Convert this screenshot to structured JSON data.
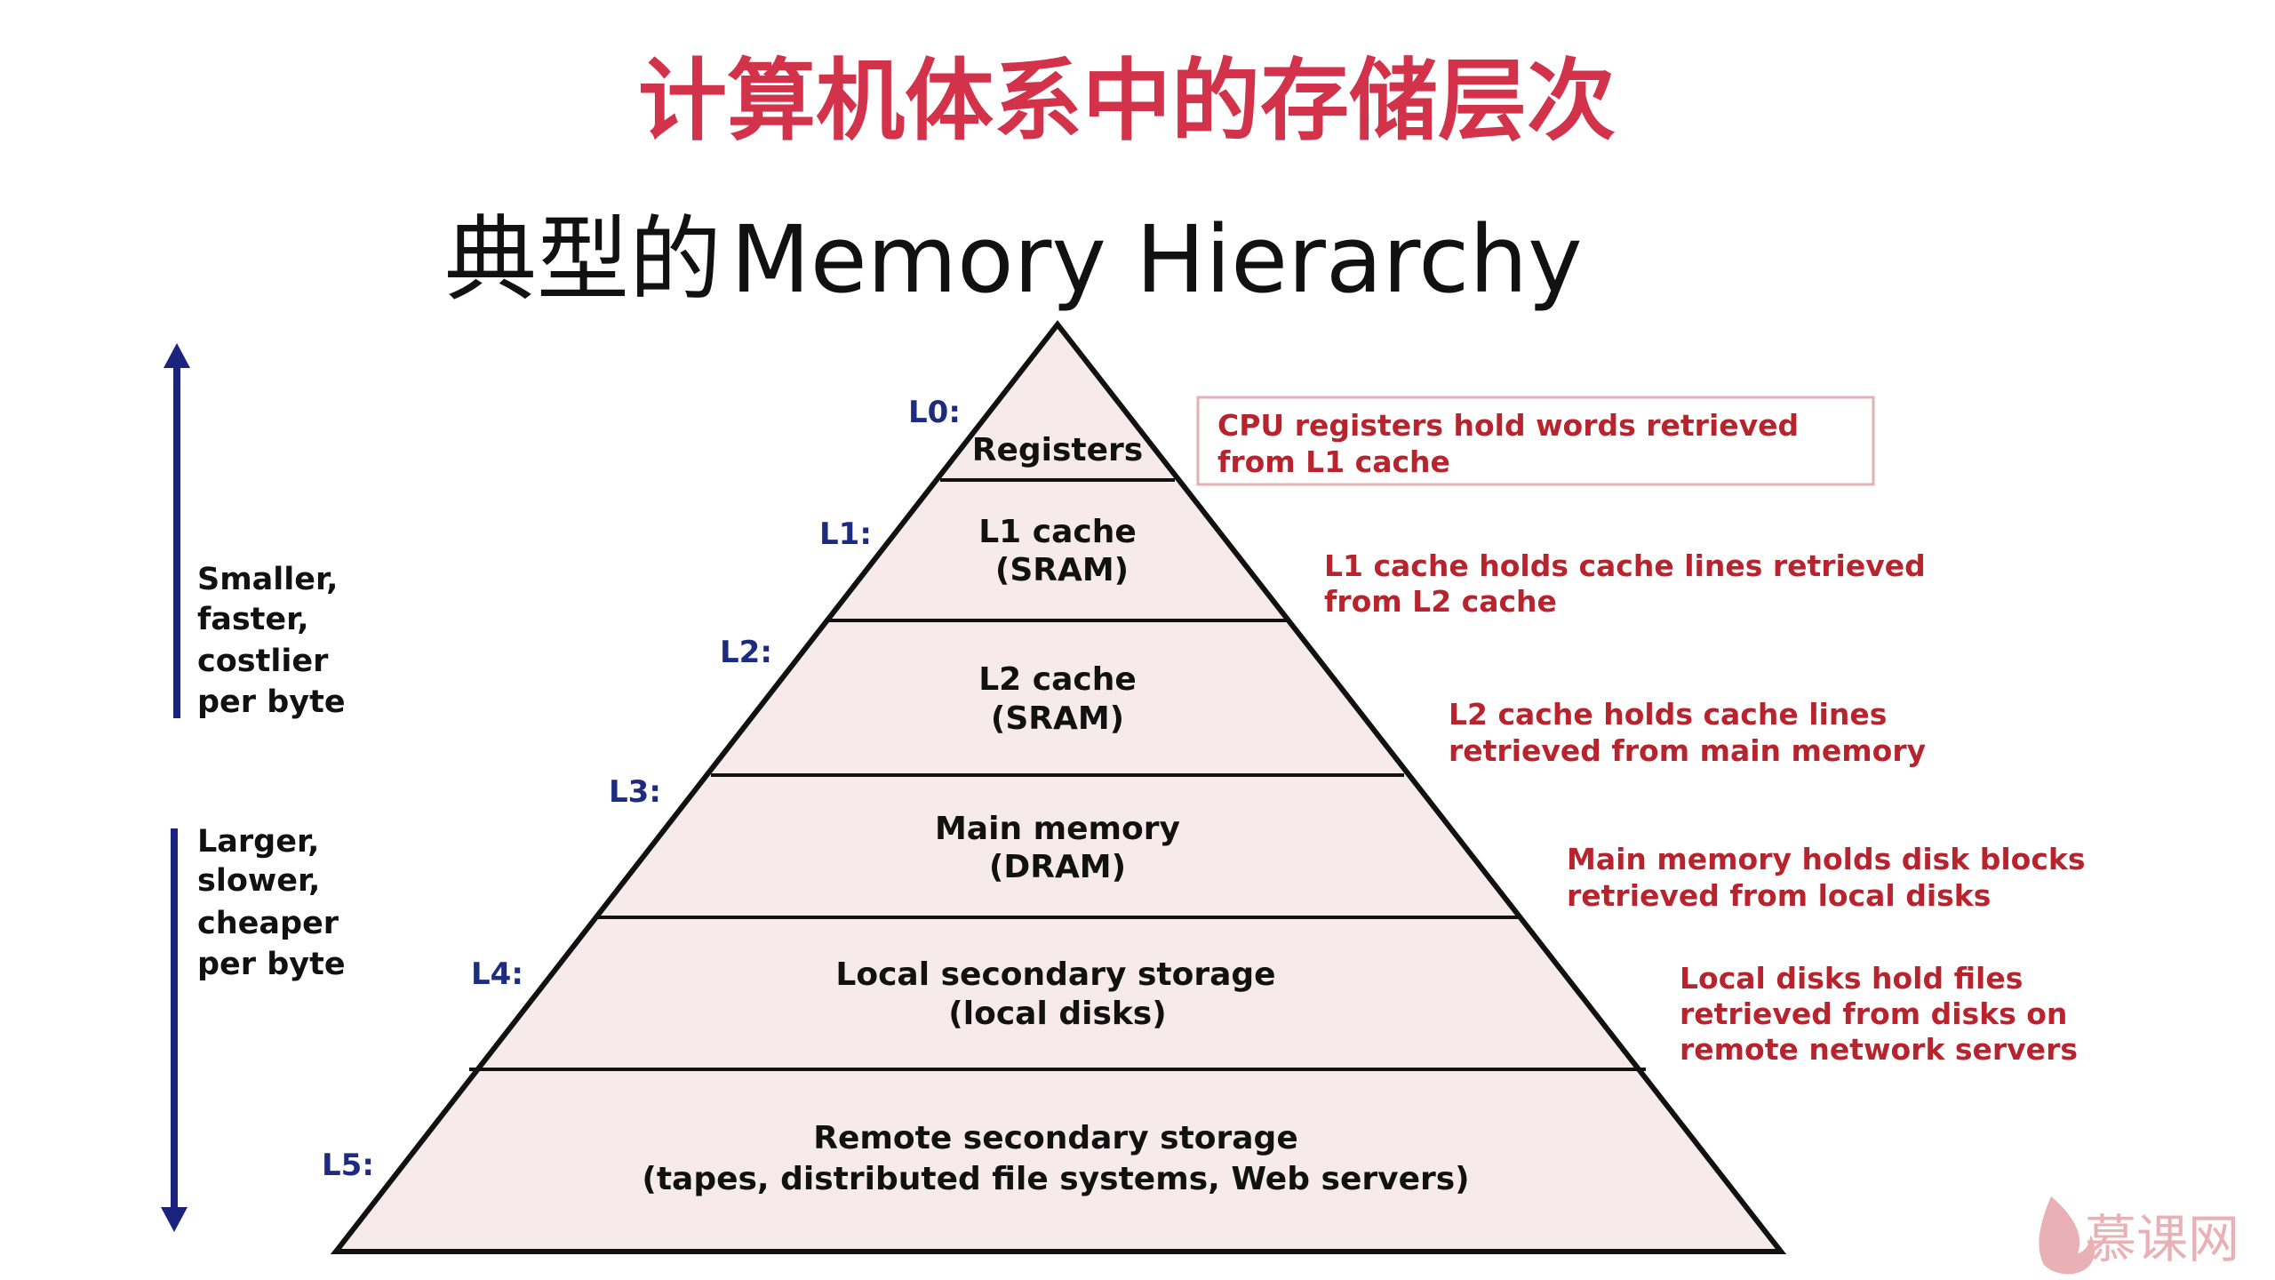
{
  "title": "计算机体系中的存储层次",
  "subtitle": {
    "cn": "典型的",
    "en": "Memory Hierarchy"
  },
  "levels": [
    {
      "id": "L0:",
      "lines": [
        "Registers"
      ]
    },
    {
      "id": "L1:",
      "lines": [
        "L1 cache",
        "(SRAM)"
      ]
    },
    {
      "id": "L2:",
      "lines": [
        "L2 cache",
        "(SRAM)"
      ]
    },
    {
      "id": "L3:",
      "lines": [
        "Main memory",
        "(DRAM)"
      ]
    },
    {
      "id": "L4:",
      "lines": [
        "Local secondary storage",
        "(local disks)"
      ]
    },
    {
      "id": "L5:",
      "lines": [
        "Remote secondary storage",
        "(tapes, distributed file systems, Web servers)"
      ]
    }
  ],
  "side_notes": {
    "top": [
      "Smaller,",
      "faster,",
      "costlier",
      "per byte"
    ],
    "bottom": [
      "Larger,",
      "slower,",
      "cheaper",
      "per byte"
    ]
  },
  "descriptions": [
    [
      "CPU registers hold words retrieved",
      "from L1 cache"
    ],
    [
      "L1 cache holds cache lines retrieved",
      "from L2 cache"
    ],
    [
      "L2 cache holds cache lines",
      "retrieved from main memory"
    ],
    [
      "Main memory holds disk blocks",
      "retrieved from local disks"
    ],
    [
      "Local disks hold files",
      "retrieved from disks on",
      "remote network servers"
    ]
  ],
  "watermark": "慕课网",
  "colors": {
    "title": "#d2334a",
    "pyramid_fill": "#f7eaec",
    "pyramid_stroke": "#111111",
    "level_label": "#1d2b80",
    "description": "#b8242e",
    "arrow": "#1a237e",
    "watermark": "#e7a9ad"
  }
}
